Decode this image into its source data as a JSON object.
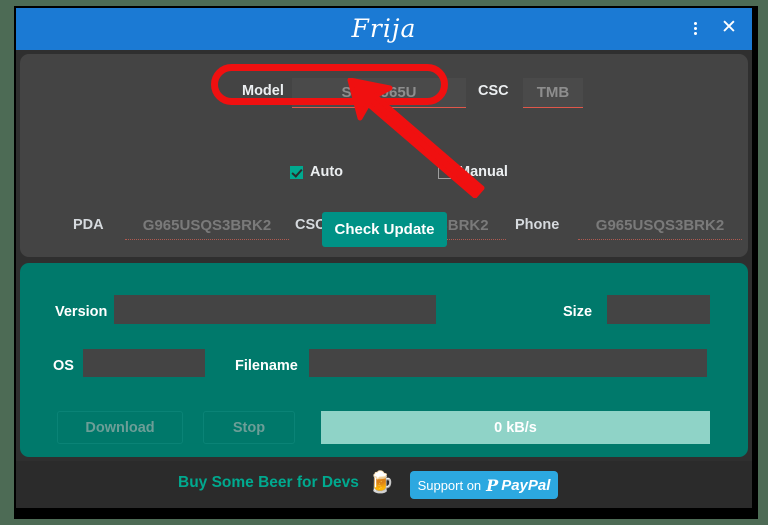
{
  "window": {
    "title": "Frija",
    "menu_icon": "kebab-menu-icon",
    "close_icon": "close-icon"
  },
  "model_section": {
    "model_label": "Model",
    "model_placeholder": "SM-G965U",
    "model_value": "",
    "csc_label": "CSC",
    "csc_placeholder": "TMB",
    "csc_value": ""
  },
  "mode": {
    "auto_label": "Auto",
    "auto_checked": true,
    "manual_label": "Manual",
    "manual_checked": false
  },
  "firmware": {
    "pda_label": "PDA",
    "pda_placeholder": "G965USQS3BRK2",
    "pda_value": "",
    "csc_label": "CSC",
    "csc_placeholder": "G965UOYN3BRK2",
    "csc_value": "",
    "phone_label": "Phone",
    "phone_placeholder": "G965USQS3BRK2",
    "phone_value": ""
  },
  "actions": {
    "check_update_label": "Check Update"
  },
  "download_panel": {
    "version_label": "Version",
    "version_value": "",
    "size_label": "Size",
    "size_value": "",
    "os_label": "OS",
    "os_value": "",
    "filename_label": "Filename",
    "filename_value": "",
    "download_label": "Download",
    "stop_label": "Stop",
    "progress_text": "0 kB/s",
    "progress_percent": 0
  },
  "footer": {
    "beer_label": "Buy Some Beer for Devs",
    "beer_icon": "beer-mug-icon",
    "paypal_support_label": "Support on",
    "paypal_brand_label": "PayPal",
    "paypal_glyph": "P"
  },
  "colors": {
    "titlebar": "#1b7ad4",
    "accent_teal": "#00796b",
    "button_teal": "#009286",
    "panel_dark": "#444444",
    "window_bg": "#2f2f2f",
    "annotation_red": "#f01010",
    "paypal_blue": "#2ca8e0",
    "link_green": "#00a98f",
    "progress_fill": "#8fd3c7"
  },
  "annotation": {
    "highlight_target": "model-input",
    "arrow_label": "pointer-arrow"
  }
}
